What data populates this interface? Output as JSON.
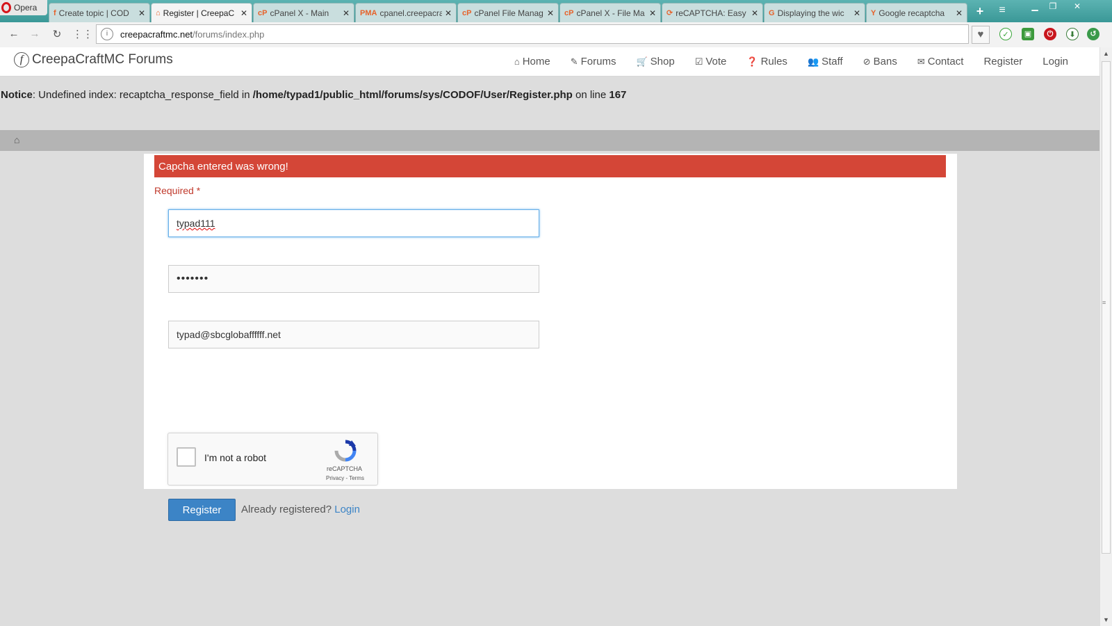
{
  "browser": {
    "opera_label": "Opera",
    "tabs": [
      {
        "title": "Create topic | COD",
        "favicon": "f"
      },
      {
        "title": "Register | CreepaC",
        "favicon": "⌂"
      },
      {
        "title": "cPanel X - Main",
        "favicon": "cP"
      },
      {
        "title": "cpanel.creepacraft",
        "favicon": "PMA"
      },
      {
        "title": "cPanel File Manag",
        "favicon": "cP"
      },
      {
        "title": "cPanel X - File Ma",
        "favicon": "cP"
      },
      {
        "title": "reCAPTCHA: Easy",
        "favicon": "⟳"
      },
      {
        "title": "Displaying the wic",
        "favicon": "G"
      },
      {
        "title": "Google recaptcha",
        "favicon": "Y"
      }
    ],
    "active_tab": 1,
    "url_domain": "creepacraftmc.net",
    "url_path": "/forums/index.php"
  },
  "site": {
    "brand": "CreepaCraftMC Forums",
    "nav": [
      {
        "label": "Home",
        "icon": "home-icon",
        "glyph": "⌂"
      },
      {
        "label": "Forums",
        "icon": "pencil-icon",
        "glyph": "✎"
      },
      {
        "label": "Shop",
        "icon": "cart-icon",
        "glyph": "🛒"
      },
      {
        "label": "Vote",
        "icon": "check-square-icon",
        "glyph": "☑"
      },
      {
        "label": "Rules",
        "icon": "question-circle-icon",
        "glyph": "❓"
      },
      {
        "label": "Staff",
        "icon": "users-icon",
        "glyph": "👥"
      },
      {
        "label": "Bans",
        "icon": "ban-icon",
        "glyph": "⊘"
      },
      {
        "label": "Contact",
        "icon": "envelope-icon",
        "glyph": "✉"
      },
      {
        "label": "Register",
        "icon": "",
        "glyph": ""
      },
      {
        "label": "Login",
        "icon": "",
        "glyph": ""
      }
    ]
  },
  "notice": {
    "prefix": "Notice",
    "message": ": Undefined index: recaptcha_response_field in ",
    "file": "/home/typad1/public_html/forums/sys/CODOF/User/Register.php",
    "on_line": " on line ",
    "line": "167"
  },
  "form": {
    "error": "Capcha entered was wrong!",
    "required": "Required *",
    "username": "typad111",
    "password": "•••••••",
    "email": "typad@sbcglobaffffff.net",
    "captcha_label": "I'm not a robot",
    "captcha_brand": "reCAPTCHA",
    "captcha_links": "Privacy - Terms",
    "submit": "Register",
    "already": "Already registered?",
    "login_link": "Login"
  },
  "colors": {
    "error_bg": "#d44637",
    "primary": "#3c84c6"
  }
}
